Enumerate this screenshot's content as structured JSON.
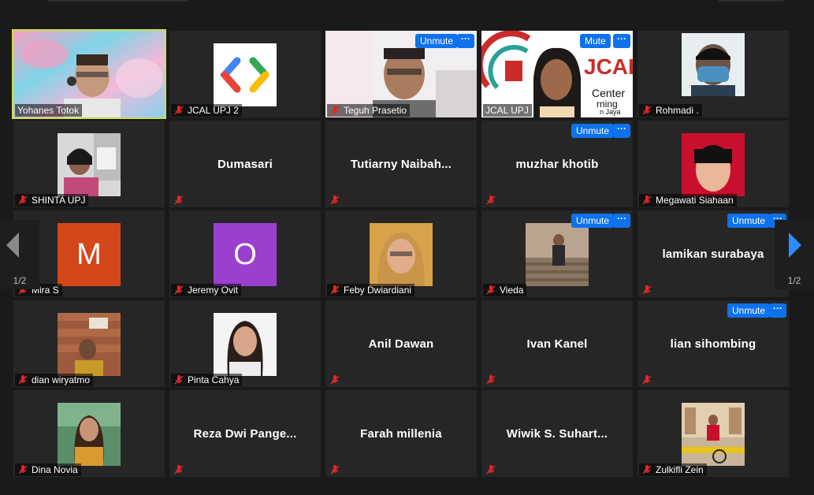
{
  "meeting": {
    "page_indicator": "1/2",
    "unmute_label": "Unmute",
    "mute_label": "Mute",
    "more_label": "···"
  },
  "participants": [
    {
      "name": "Yohanes Totok",
      "display": "video"
    },
    {
      "name": "JCAL UPJ 2",
      "display": "logo"
    },
    {
      "name": "Teguh Prasetio",
      "display": "video"
    },
    {
      "name": "JCAL UPJ",
      "display": "video"
    },
    {
      "name": "Rohmadi .",
      "display": "photo"
    },
    {
      "name": "SHINTA UPJ",
      "display": "photo"
    },
    {
      "name": "Dumasari",
      "display": "name"
    },
    {
      "name": "Tutiarny  Naibah...",
      "display": "name"
    },
    {
      "name": "muzhar khotib",
      "display": "name"
    },
    {
      "name": "Megawati Siahaan",
      "display": "photo"
    },
    {
      "name": "Mira S",
      "display": "letter",
      "letter": "M"
    },
    {
      "name": "Jeremy Ovit",
      "display": "letter",
      "letter": "O"
    },
    {
      "name": "Feby Dwiardiani",
      "display": "photo"
    },
    {
      "name": "Vieda",
      "display": "photo"
    },
    {
      "name": "lamikan surabaya",
      "display": "name"
    },
    {
      "name": "dian wiryatmo",
      "display": "photo"
    },
    {
      "name": "Pinta Cahya",
      "display": "photo"
    },
    {
      "name": "Anil Dawan",
      "display": "name"
    },
    {
      "name": "Ivan Kanel",
      "display": "name"
    },
    {
      "name": "lian sihombing",
      "display": "name"
    },
    {
      "name": "Dina Novia",
      "display": "photo"
    },
    {
      "name": "Reza  Dwi  Pange...",
      "display": "name"
    },
    {
      "name": "Farah millenia",
      "display": "name"
    },
    {
      "name": "Wiwik  S.  Suhart...",
      "display": "name"
    },
    {
      "name": "Zulkifli Zein",
      "display": "photo"
    }
  ],
  "tile_logo_text": {
    "jcal_line1": "JCAL",
    "jcal_line2": "Center",
    "jcal_line3": "rning",
    "jcal_line4": "n Jaya"
  },
  "colors": {
    "accent": "#0e72ed",
    "active_speaker_border": "#cbe049",
    "muted_icon": "#e02828",
    "avatar_m": "#d4471b",
    "avatar_o": "#9b3fcf"
  }
}
